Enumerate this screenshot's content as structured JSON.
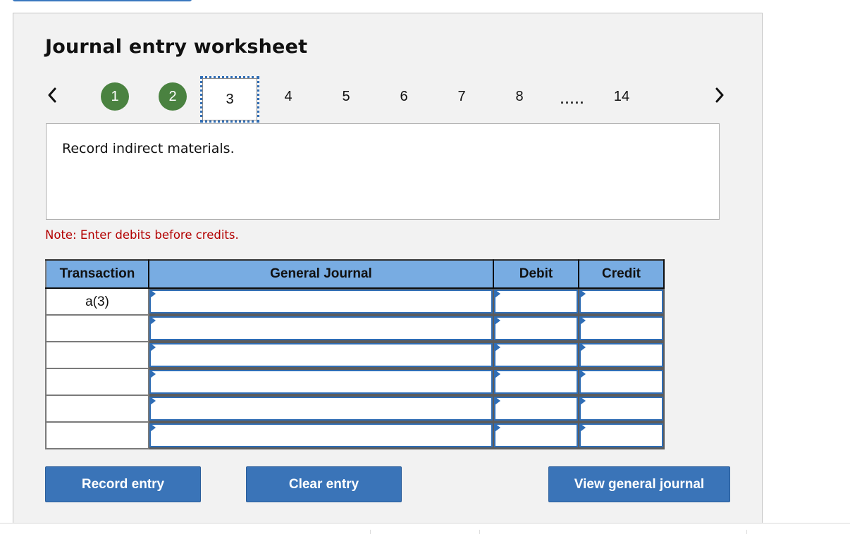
{
  "worksheet": {
    "title": "Journal entry worksheet",
    "pager": {
      "prev_icon": "chevron-left-icon",
      "next_icon": "chevron-right-icon",
      "steps": [
        {
          "label": "1",
          "state": "completed"
        },
        {
          "label": "2",
          "state": "completed"
        },
        {
          "label": "3",
          "state": "current"
        },
        {
          "label": "4",
          "state": "pending"
        },
        {
          "label": "5",
          "state": "pending"
        },
        {
          "label": "6",
          "state": "pending"
        },
        {
          "label": "7",
          "state": "pending"
        },
        {
          "label": "8",
          "state": "pending"
        }
      ],
      "ellipsis": ".....",
      "last_step": "14"
    },
    "prompt": "Record indirect materials.",
    "note": "Note: Enter debits before credits.",
    "colors": {
      "completed_step": "#4a8240",
      "header_bg": "#78ace2",
      "button_bg": "#3a74b8",
      "note_color": "#b30000",
      "input_border": "#2f6db5"
    }
  },
  "table": {
    "headers": {
      "transaction": "Transaction",
      "general_journal": "General Journal",
      "debit": "Debit",
      "credit": "Credit"
    },
    "rows": [
      {
        "transaction": "a(3)",
        "account": "",
        "debit": "",
        "credit": ""
      },
      {
        "transaction": "",
        "account": "",
        "debit": "",
        "credit": ""
      },
      {
        "transaction": "",
        "account": "",
        "debit": "",
        "credit": ""
      },
      {
        "transaction": "",
        "account": "",
        "debit": "",
        "credit": ""
      },
      {
        "transaction": "",
        "account": "",
        "debit": "",
        "credit": ""
      },
      {
        "transaction": "",
        "account": "",
        "debit": "",
        "credit": ""
      }
    ]
  },
  "buttons": {
    "record": "Record entry",
    "clear": "Clear entry",
    "view": "View general journal"
  }
}
